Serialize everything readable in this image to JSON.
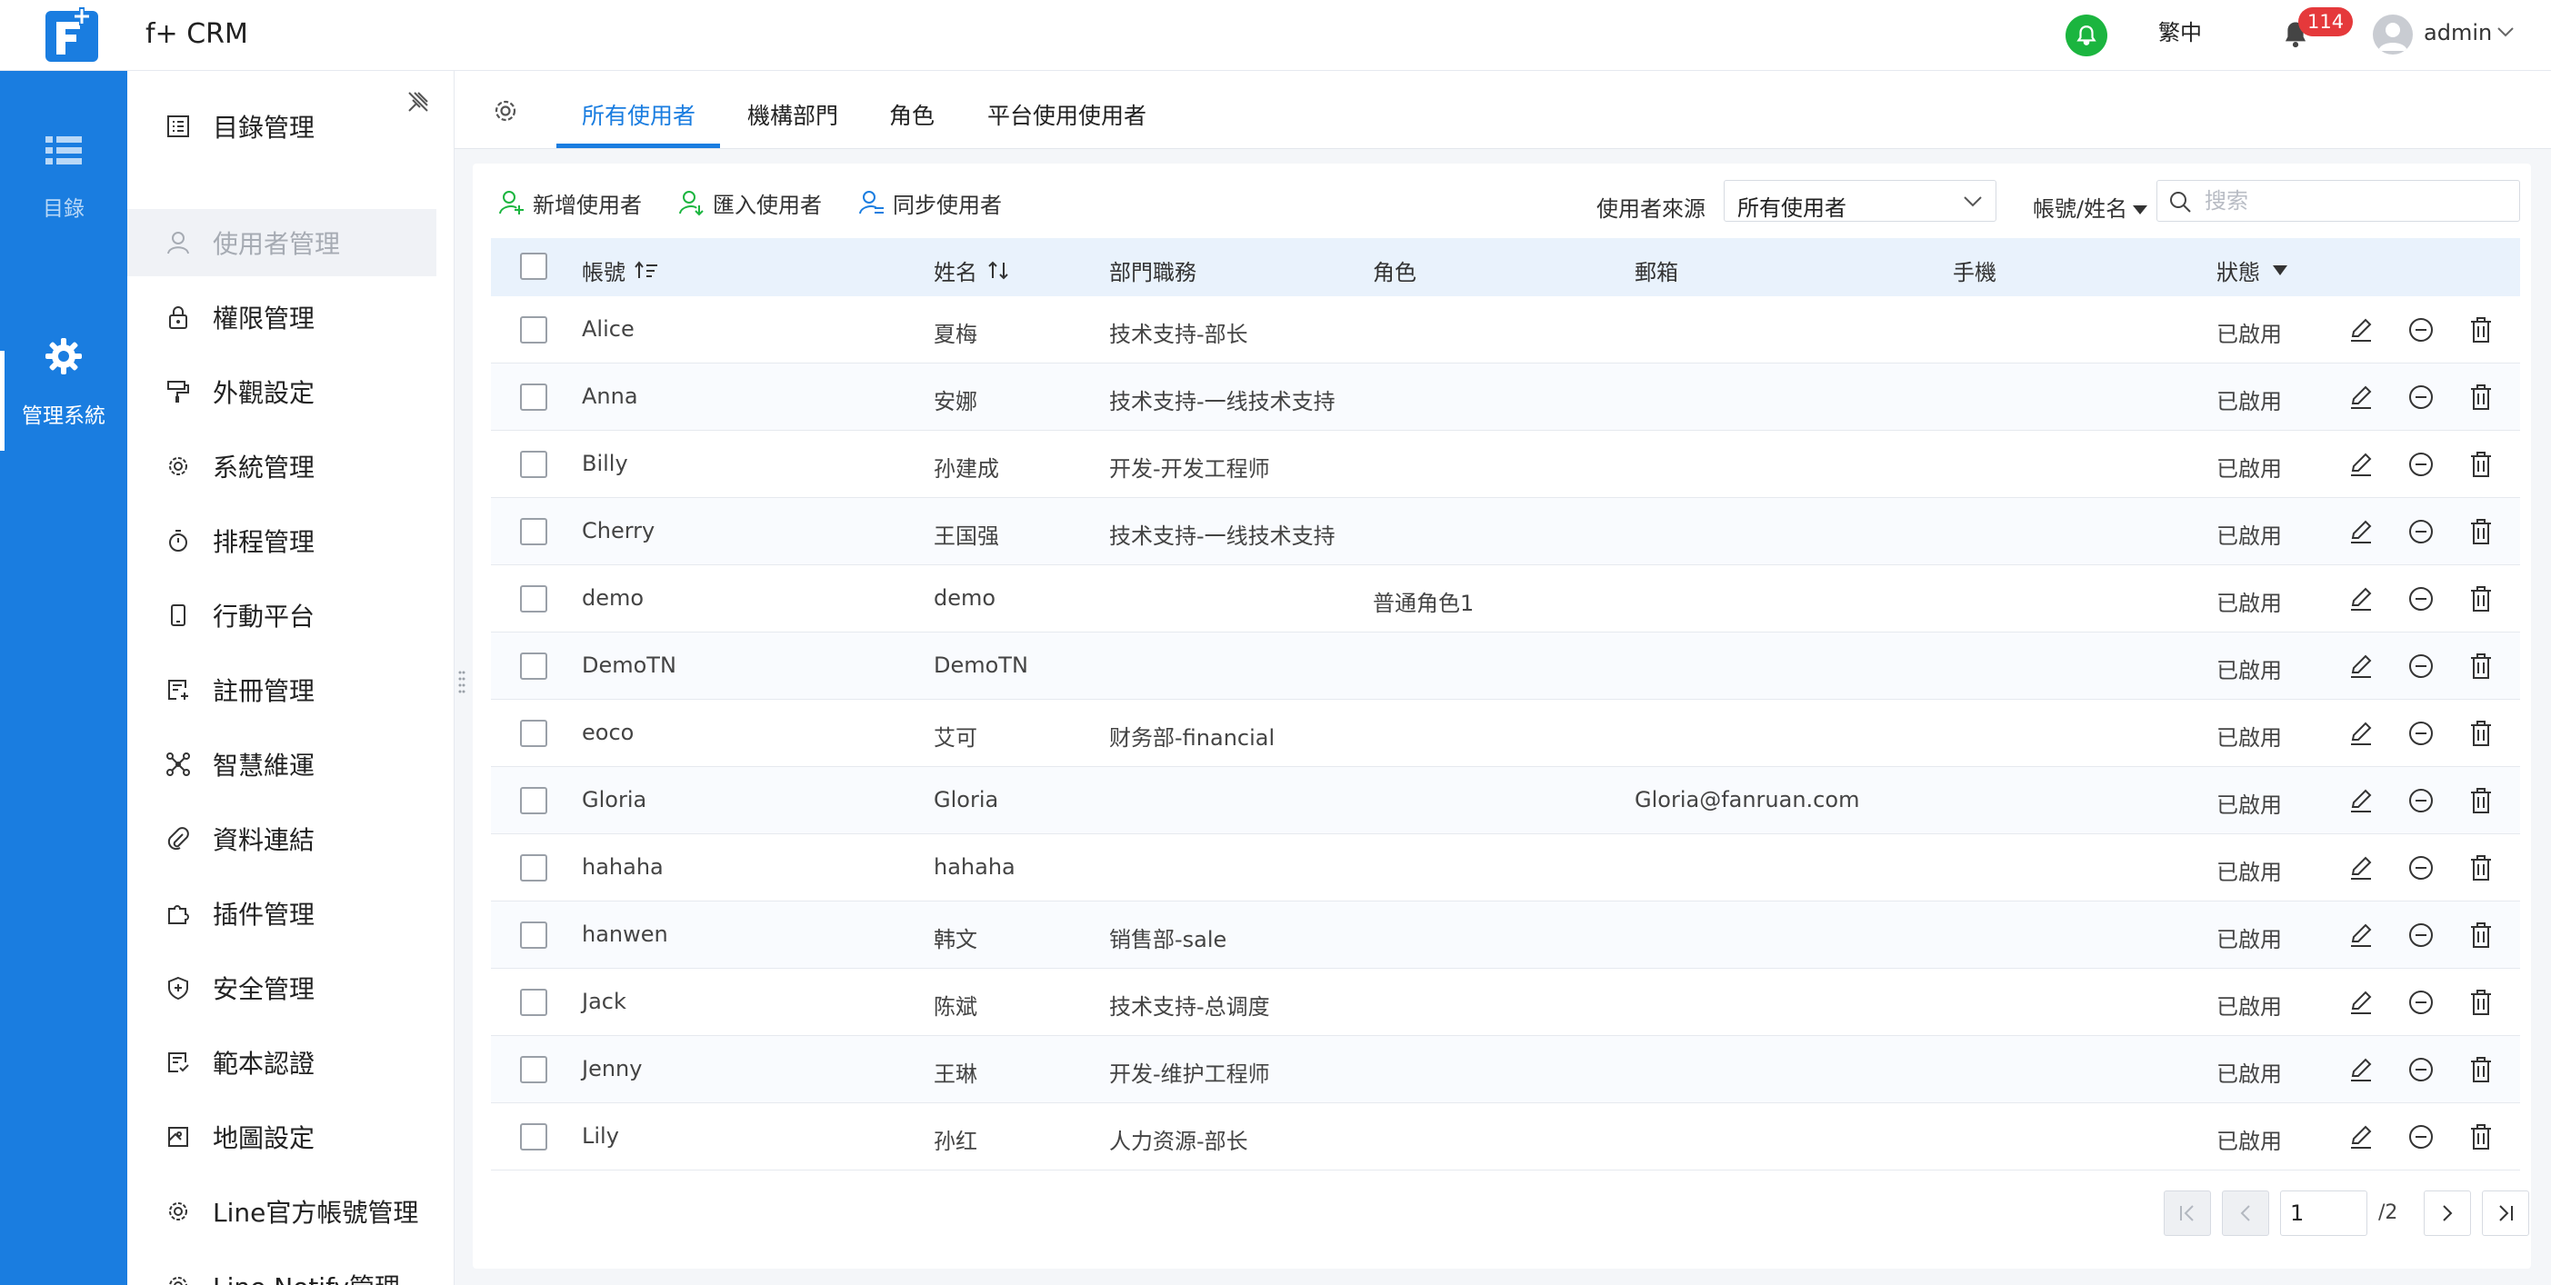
{
  "app": {
    "title": "f+ CRM"
  },
  "topbar": {
    "language": "繁中",
    "notification_count": "114",
    "user": "admin"
  },
  "rail": {
    "items": [
      {
        "label": "目錄",
        "icon": "list-icon"
      },
      {
        "label": "管理系統",
        "icon": "gear-icon"
      }
    ]
  },
  "sidebar": {
    "items": [
      {
        "label": "目錄管理",
        "icon": "catalog-icon"
      },
      {
        "label": "使用者管理",
        "icon": "user-icon"
      },
      {
        "label": "權限管理",
        "icon": "lock-icon"
      },
      {
        "label": "外觀設定",
        "icon": "paint-roller-icon"
      },
      {
        "label": "系統管理",
        "icon": "gear-icon"
      },
      {
        "label": "排程管理",
        "icon": "timer-icon"
      },
      {
        "label": "行動平台",
        "icon": "mobile-icon"
      },
      {
        "label": "註冊管理",
        "icon": "register-icon"
      },
      {
        "label": "智慧維運",
        "icon": "network-icon"
      },
      {
        "label": "資料連結",
        "icon": "paperclip-icon"
      },
      {
        "label": "插件管理",
        "icon": "puzzle-icon"
      },
      {
        "label": "安全管理",
        "icon": "shield-icon"
      },
      {
        "label": "範本認證",
        "icon": "template-icon"
      },
      {
        "label": "地圖設定",
        "icon": "map-icon"
      },
      {
        "label": "Line官方帳號管理",
        "icon": "gear-icon"
      },
      {
        "label": "Line Notify管理",
        "icon": "gear-icon"
      }
    ]
  },
  "tabs": [
    {
      "label": "所有使用者"
    },
    {
      "label": "機構部門"
    },
    {
      "label": "角色"
    },
    {
      "label": "平台使用使用者"
    }
  ],
  "toolbar": {
    "add_user": "新增使用者",
    "import_user": "匯入使用者",
    "sync_user": "同步使用者",
    "source_label": "使用者來源",
    "source_value": "所有使用者",
    "account_filter": "帳號/姓名",
    "search_placeholder": "搜索"
  },
  "table": {
    "headers": {
      "account": "帳號",
      "name": "姓名",
      "department": "部門職務",
      "role": "角色",
      "email": "郵箱",
      "phone": "手機",
      "status": "狀態"
    },
    "rows": [
      {
        "account": "Alice",
        "name": "夏梅",
        "department": "技术支持-部长",
        "role": "",
        "email": "",
        "phone": "",
        "status": "已啟用"
      },
      {
        "account": "Anna",
        "name": "安娜",
        "department": "技术支持-一线技术支持",
        "role": "",
        "email": "",
        "phone": "",
        "status": "已啟用"
      },
      {
        "account": "Billy",
        "name": "孙建成",
        "department": "开发-开发工程师",
        "role": "",
        "email": "",
        "phone": "",
        "status": "已啟用"
      },
      {
        "account": "Cherry",
        "name": "王国强",
        "department": "技术支持-一线技术支持",
        "role": "",
        "email": "",
        "phone": "",
        "status": "已啟用"
      },
      {
        "account": "demo",
        "name": "demo",
        "department": "",
        "role": "普通角色1",
        "email": "",
        "phone": "",
        "status": "已啟用"
      },
      {
        "account": "DemoTN",
        "name": "DemoTN",
        "department": "",
        "role": "",
        "email": "",
        "phone": "",
        "status": "已啟用"
      },
      {
        "account": "eoco",
        "name": "艾可",
        "department": "财务部-financial",
        "role": "",
        "email": "",
        "phone": "",
        "status": "已啟用"
      },
      {
        "account": "Gloria",
        "name": "Gloria",
        "department": "",
        "role": "",
        "email": "Gloria@fanruan.com",
        "phone": "",
        "status": "已啟用"
      },
      {
        "account": "hahaha",
        "name": "hahaha",
        "department": "",
        "role": "",
        "email": "",
        "phone": "",
        "status": "已啟用"
      },
      {
        "account": "hanwen",
        "name": "韩文",
        "department": "销售部-sale",
        "role": "",
        "email": "",
        "phone": "",
        "status": "已啟用"
      },
      {
        "account": "Jack",
        "name": "陈斌",
        "department": "技术支持-总调度",
        "role": "",
        "email": "",
        "phone": "",
        "status": "已啟用"
      },
      {
        "account": "Jenny",
        "name": "王琳",
        "department": "开发-维护工程师",
        "role": "",
        "email": "",
        "phone": "",
        "status": "已啟用"
      },
      {
        "account": "Lily",
        "name": "孙红",
        "department": "人力资源-部长",
        "role": "",
        "email": "",
        "phone": "",
        "status": "已啟用"
      }
    ]
  },
  "pagination": {
    "current": "1",
    "total": "/2"
  },
  "colors": {
    "primary": "#1a7de0",
    "green": "#1bb53f",
    "badge": "#e5393b"
  }
}
